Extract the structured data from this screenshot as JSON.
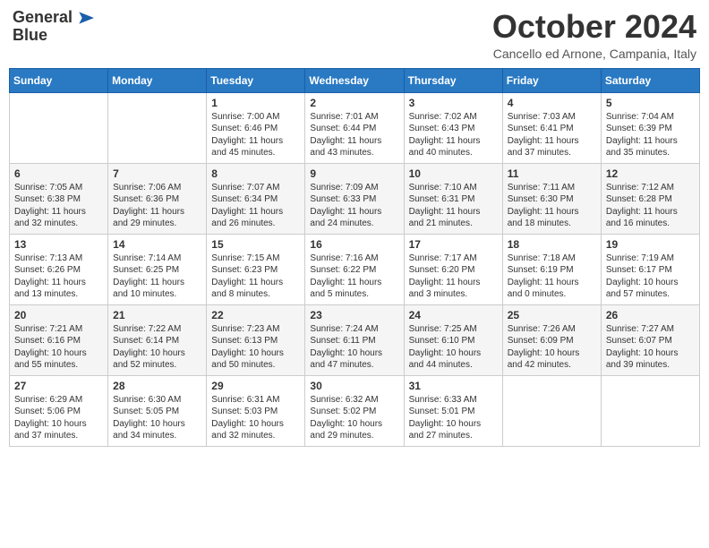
{
  "logo": {
    "general": "General",
    "blue": "Blue"
  },
  "header": {
    "month": "October 2024",
    "location": "Cancello ed Arnone, Campania, Italy"
  },
  "weekdays": [
    "Sunday",
    "Monday",
    "Tuesday",
    "Wednesday",
    "Thursday",
    "Friday",
    "Saturday"
  ],
  "weeks": [
    [
      {
        "day": "",
        "text": ""
      },
      {
        "day": "",
        "text": ""
      },
      {
        "day": "1",
        "text": "Sunrise: 7:00 AM\nSunset: 6:46 PM\nDaylight: 11 hours and 45 minutes."
      },
      {
        "day": "2",
        "text": "Sunrise: 7:01 AM\nSunset: 6:44 PM\nDaylight: 11 hours and 43 minutes."
      },
      {
        "day": "3",
        "text": "Sunrise: 7:02 AM\nSunset: 6:43 PM\nDaylight: 11 hours and 40 minutes."
      },
      {
        "day": "4",
        "text": "Sunrise: 7:03 AM\nSunset: 6:41 PM\nDaylight: 11 hours and 37 minutes."
      },
      {
        "day": "5",
        "text": "Sunrise: 7:04 AM\nSunset: 6:39 PM\nDaylight: 11 hours and 35 minutes."
      }
    ],
    [
      {
        "day": "6",
        "text": "Sunrise: 7:05 AM\nSunset: 6:38 PM\nDaylight: 11 hours and 32 minutes."
      },
      {
        "day": "7",
        "text": "Sunrise: 7:06 AM\nSunset: 6:36 PM\nDaylight: 11 hours and 29 minutes."
      },
      {
        "day": "8",
        "text": "Sunrise: 7:07 AM\nSunset: 6:34 PM\nDaylight: 11 hours and 26 minutes."
      },
      {
        "day": "9",
        "text": "Sunrise: 7:09 AM\nSunset: 6:33 PM\nDaylight: 11 hours and 24 minutes."
      },
      {
        "day": "10",
        "text": "Sunrise: 7:10 AM\nSunset: 6:31 PM\nDaylight: 11 hours and 21 minutes."
      },
      {
        "day": "11",
        "text": "Sunrise: 7:11 AM\nSunset: 6:30 PM\nDaylight: 11 hours and 18 minutes."
      },
      {
        "day": "12",
        "text": "Sunrise: 7:12 AM\nSunset: 6:28 PM\nDaylight: 11 hours and 16 minutes."
      }
    ],
    [
      {
        "day": "13",
        "text": "Sunrise: 7:13 AM\nSunset: 6:26 PM\nDaylight: 11 hours and 13 minutes."
      },
      {
        "day": "14",
        "text": "Sunrise: 7:14 AM\nSunset: 6:25 PM\nDaylight: 11 hours and 10 minutes."
      },
      {
        "day": "15",
        "text": "Sunrise: 7:15 AM\nSunset: 6:23 PM\nDaylight: 11 hours and 8 minutes."
      },
      {
        "day": "16",
        "text": "Sunrise: 7:16 AM\nSunset: 6:22 PM\nDaylight: 11 hours and 5 minutes."
      },
      {
        "day": "17",
        "text": "Sunrise: 7:17 AM\nSunset: 6:20 PM\nDaylight: 11 hours and 3 minutes."
      },
      {
        "day": "18",
        "text": "Sunrise: 7:18 AM\nSunset: 6:19 PM\nDaylight: 11 hours and 0 minutes."
      },
      {
        "day": "19",
        "text": "Sunrise: 7:19 AM\nSunset: 6:17 PM\nDaylight: 10 hours and 57 minutes."
      }
    ],
    [
      {
        "day": "20",
        "text": "Sunrise: 7:21 AM\nSunset: 6:16 PM\nDaylight: 10 hours and 55 minutes."
      },
      {
        "day": "21",
        "text": "Sunrise: 7:22 AM\nSunset: 6:14 PM\nDaylight: 10 hours and 52 minutes."
      },
      {
        "day": "22",
        "text": "Sunrise: 7:23 AM\nSunset: 6:13 PM\nDaylight: 10 hours and 50 minutes."
      },
      {
        "day": "23",
        "text": "Sunrise: 7:24 AM\nSunset: 6:11 PM\nDaylight: 10 hours and 47 minutes."
      },
      {
        "day": "24",
        "text": "Sunrise: 7:25 AM\nSunset: 6:10 PM\nDaylight: 10 hours and 44 minutes."
      },
      {
        "day": "25",
        "text": "Sunrise: 7:26 AM\nSunset: 6:09 PM\nDaylight: 10 hours and 42 minutes."
      },
      {
        "day": "26",
        "text": "Sunrise: 7:27 AM\nSunset: 6:07 PM\nDaylight: 10 hours and 39 minutes."
      }
    ],
    [
      {
        "day": "27",
        "text": "Sunrise: 6:29 AM\nSunset: 5:06 PM\nDaylight: 10 hours and 37 minutes."
      },
      {
        "day": "28",
        "text": "Sunrise: 6:30 AM\nSunset: 5:05 PM\nDaylight: 10 hours and 34 minutes."
      },
      {
        "day": "29",
        "text": "Sunrise: 6:31 AM\nSunset: 5:03 PM\nDaylight: 10 hours and 32 minutes."
      },
      {
        "day": "30",
        "text": "Sunrise: 6:32 AM\nSunset: 5:02 PM\nDaylight: 10 hours and 29 minutes."
      },
      {
        "day": "31",
        "text": "Sunrise: 6:33 AM\nSunset: 5:01 PM\nDaylight: 10 hours and 27 minutes."
      },
      {
        "day": "",
        "text": ""
      },
      {
        "day": "",
        "text": ""
      }
    ]
  ]
}
